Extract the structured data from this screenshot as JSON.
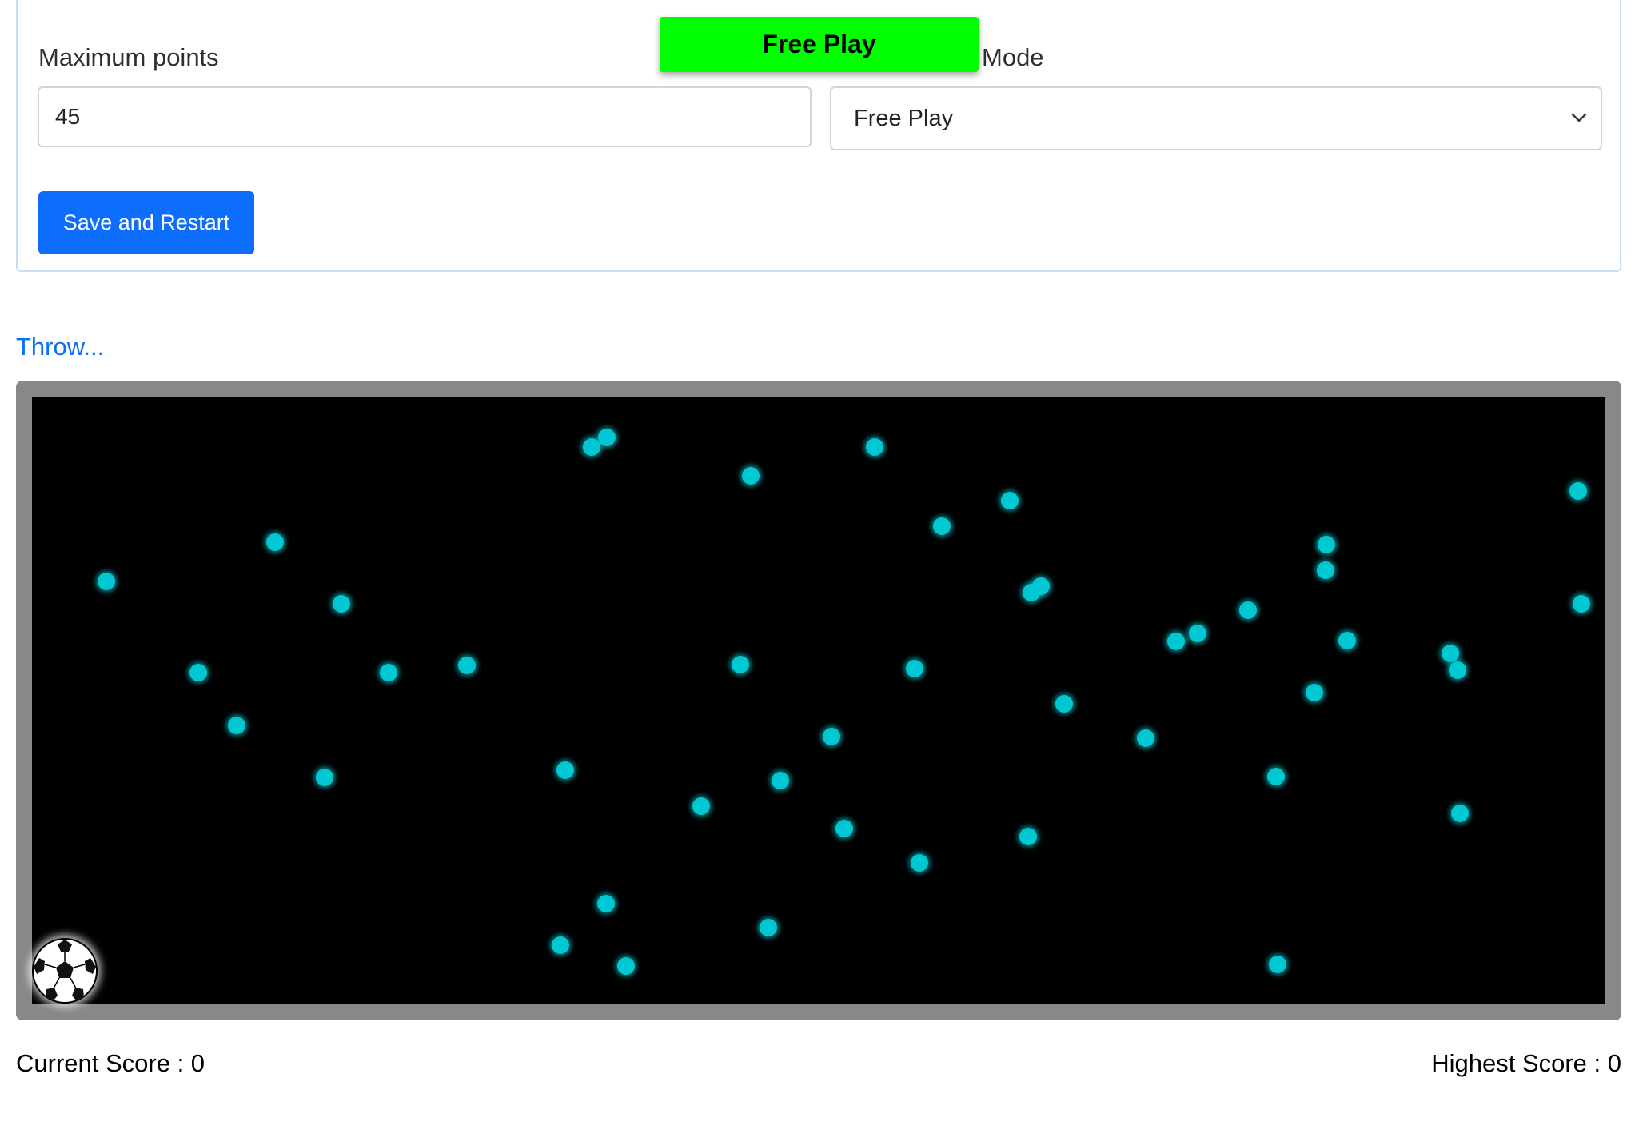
{
  "settings": {
    "max_points_label": "Maximum points",
    "max_points_value": "45",
    "mode_label": "Mode",
    "mode_selected": "Free Play",
    "save_label": "Save and Restart"
  },
  "mode_banner": "Free Play",
  "throw_label": "Throw...",
  "game": {
    "point_color": "#00c8d2",
    "background_color": "#000000",
    "frame_color": "#888888",
    "ball_icon": "soccer-ball-icon"
  },
  "scores": {
    "current_label": "Current Score : 0",
    "highest_label": "Highest Score : 0"
  }
}
